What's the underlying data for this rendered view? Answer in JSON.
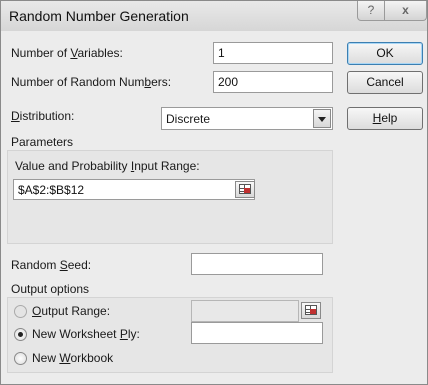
{
  "window": {
    "title": "Random Number Generation",
    "help_glyph": "?",
    "close_glyph": "x"
  },
  "fields": {
    "num_variables": {
      "label_pre": "Number of ",
      "label_key": "V",
      "label_post": "ariables:",
      "value": "1"
    },
    "num_random": {
      "label_pre": "Number of Random Num",
      "label_key": "b",
      "label_post": "ers:",
      "value": "200"
    },
    "distribution": {
      "label_key": "D",
      "label_post": "istribution:",
      "value": "Discrete"
    }
  },
  "buttons": {
    "ok": "OK",
    "cancel": "Cancel",
    "help_key": "H",
    "help_post": "elp"
  },
  "parameters": {
    "heading": "Parameters",
    "range_label_pre": "Value and Probability ",
    "range_label_key": "I",
    "range_label_post": "nput Range:",
    "range_value": "$A$2:$B$12"
  },
  "seed": {
    "label_pre": "Random ",
    "label_key": "S",
    "label_post": "eed:",
    "value": ""
  },
  "output": {
    "heading": "Output options",
    "output_range": {
      "label_key": "O",
      "label_post": "utput Range:",
      "value": "",
      "selected": false
    },
    "new_worksheet": {
      "label_pre": "New Worksheet ",
      "label_key": "P",
      "label_post": "ly:",
      "value": "",
      "selected": true
    },
    "new_workbook": {
      "label_pre": "New ",
      "label_key": "W",
      "label_post": "orkbook",
      "selected": false
    }
  }
}
